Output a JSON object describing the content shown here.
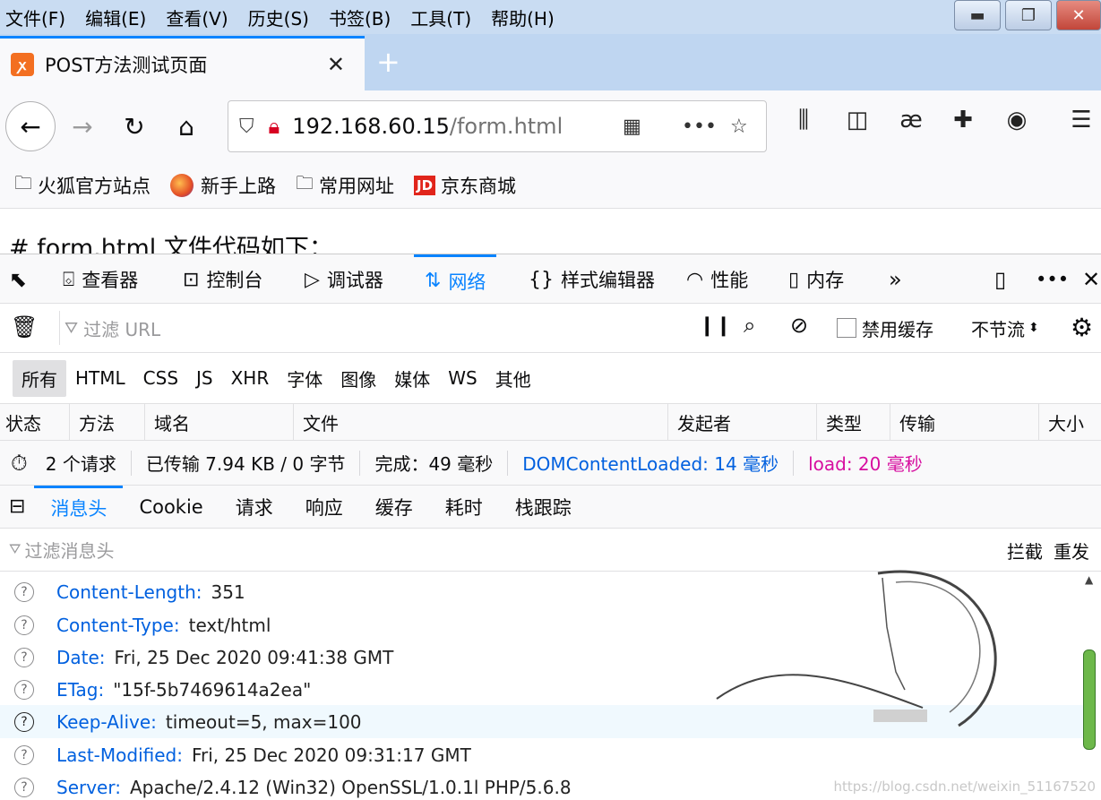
{
  "menubar": {
    "items": [
      "文件(F)",
      "编辑(E)",
      "查看(V)",
      "历史(S)",
      "书签(B)",
      "工具(T)",
      "帮助(H)"
    ]
  },
  "tab": {
    "title": "POST方法测试页面",
    "favicon": "xampp-icon"
  },
  "navbar": {
    "url_host": "192.168.60.15",
    "url_path": "/form.html"
  },
  "bookmarks": [
    {
      "label": "火狐官方站点",
      "icon": "folder-icon"
    },
    {
      "label": "新手上路",
      "icon": "firefox-icon"
    },
    {
      "label": "常用网址",
      "icon": "folder-icon"
    },
    {
      "label": "京东商城",
      "icon": "jd-icon",
      "badge": "JD"
    }
  ],
  "page": {
    "heading": "# form.html 文件代码如下："
  },
  "devtools": {
    "tabs": [
      {
        "label": "查看器",
        "icon": "inspector-icon"
      },
      {
        "label": "控制台",
        "icon": "console-icon"
      },
      {
        "label": "调试器",
        "icon": "debugger-icon"
      },
      {
        "label": "网络",
        "icon": "network-icon",
        "selected": true
      },
      {
        "label": "样式编辑器",
        "icon": "style-editor-icon"
      },
      {
        "label": "性能",
        "icon": "performance-icon"
      },
      {
        "label": "内存",
        "icon": "memory-icon"
      }
    ],
    "filter_placeholder": "过滤 URL",
    "disable_cache_label": "禁用缓存",
    "throttle_label": "不节流",
    "type_filters": [
      "所有",
      "HTML",
      "CSS",
      "JS",
      "XHR",
      "字体",
      "图像",
      "媒体",
      "WS",
      "其他"
    ],
    "columns": [
      "状态",
      "方法",
      "域名",
      "文件",
      "发起者",
      "类型",
      "传输",
      "大小"
    ],
    "summary": {
      "requests": "2 个请求",
      "transferred": "已传输 7.94 KB / 0 字节",
      "finish": "完成：49 毫秒",
      "dcl": "DOMContentLoaded: 14 毫秒",
      "load": "load: 20 毫秒"
    },
    "side_tabs": [
      "消息头",
      "Cookie",
      "请求",
      "响应",
      "缓存",
      "耗时",
      "栈跟踪"
    ],
    "header_filter_placeholder": "过滤消息头",
    "block_label": "拦截",
    "resend_label": "重发",
    "headers": [
      {
        "name": "Content-Length:",
        "value": "351"
      },
      {
        "name": "Content-Type:",
        "value": "text/html"
      },
      {
        "name": "Date:",
        "value": "Fri, 25 Dec 2020 09:41:38 GMT"
      },
      {
        "name": "ETag:",
        "value": "\"15f-5b7469614a2ea\""
      },
      {
        "name": "Keep-Alive:",
        "value": "timeout=5, max=100"
      },
      {
        "name": "Last-Modified:",
        "value": "Fri, 25 Dec 2020 09:31:17 GMT"
      },
      {
        "name": "Server:",
        "value": "Apache/2.4.12 (Win32) OpenSSL/1.0.1l PHP/5.6.8"
      }
    ]
  },
  "watermark": "https://blog.csdn.net/weixin_51167520",
  "colors": {
    "accent": "#0a84ff",
    "dcl": "#0060df",
    "load": "#d70fa0"
  }
}
